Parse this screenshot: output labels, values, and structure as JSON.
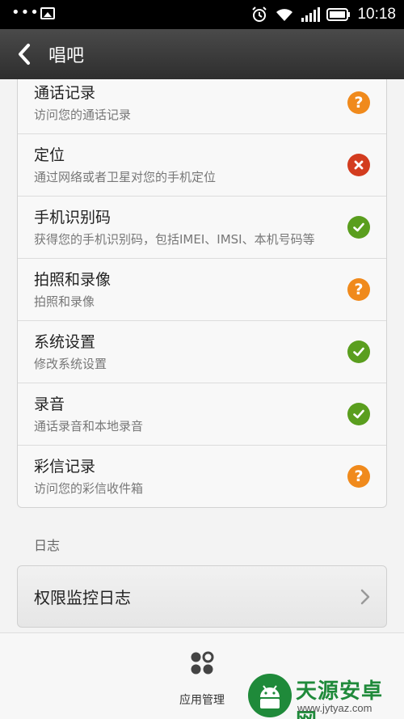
{
  "status_bar": {
    "dots": "•••",
    "time": "10:18",
    "icons": [
      "image-icon",
      "alarm-icon",
      "wifi-icon",
      "signal-icon",
      "battery-icon"
    ]
  },
  "header": {
    "title": "唱吧",
    "back_icon": "chevron-left-icon"
  },
  "permissions": [
    {
      "title": "通话记录",
      "desc": "访问您的通话记录",
      "status": "ask"
    },
    {
      "title": "定位",
      "desc": "通过网络或者卫星对您的手机定位",
      "status": "deny"
    },
    {
      "title": "手机识别码",
      "desc": "获得您的手机识别码，包括IMEI、IMSI、本机号码等",
      "status": "allow"
    },
    {
      "title": "拍照和录像",
      "desc": "拍照和录像",
      "status": "ask"
    },
    {
      "title": "系统设置",
      "desc": "修改系统设置",
      "status": "allow"
    },
    {
      "title": "录音",
      "desc": "通话录音和本地录音",
      "status": "allow"
    },
    {
      "title": "彩信记录",
      "desc": "访问您的彩信收件箱",
      "status": "ask"
    }
  ],
  "log_section": {
    "label": "日志",
    "item": "权限监控日志"
  },
  "bottom_bar": {
    "app_management": "应用管理"
  },
  "watermark": {
    "name": "天源安卓网",
    "url": "www.jytyaz.com"
  },
  "colors": {
    "allow": "#5a9e1e",
    "deny": "#d33c1f",
    "ask": "#f08a1c",
    "watermark_green": "#1f8a3a"
  }
}
